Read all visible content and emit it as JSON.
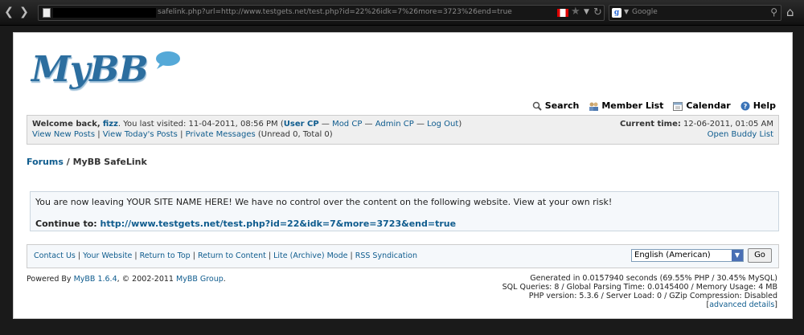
{
  "browser": {
    "url": "safelink.php?url=http://www.testgets.net/test.php?id=22%26idk=7%26more=3723%26end=true",
    "search_placeholder": "Google"
  },
  "logo": "MyBB",
  "toplinks": {
    "search": "Search",
    "member_list": "Member List",
    "calendar": "Calendar",
    "help": "Help"
  },
  "welcome": {
    "prefix": "Welcome back,",
    "user": "fizz",
    "visited": ". You last visited: 11-04-2011, 08:56 PM (",
    "user_cp": "User CP",
    "dash1": " — ",
    "mod_cp": "Mod CP",
    "dash2": " — ",
    "admin_cp": "Admin CP",
    "dash3": " — ",
    "log_out": "Log Out",
    "close": ")",
    "new_posts": "View New Posts",
    "pipe1": " | ",
    "today_posts": "View Today's Posts",
    "pipe2": " | ",
    "pm": "Private Messages",
    "pm_status": " (Unread 0, Total 0)",
    "time_label": "Current time:",
    "time_value": " 12-06-2011, 01:05 AM",
    "buddy_list": "Open Buddy List"
  },
  "breadcrumb": {
    "forums": "Forums",
    "sep": " / ",
    "current": "MyBB SafeLink"
  },
  "notice": {
    "message": "You are now leaving YOUR SITE NAME HERE! We have no control over the content on the following website. View at your own risk!",
    "continue_label": "Continue to: ",
    "continue_url": "http://www.testgets.net/test.php?id=22&idk=7&more=3723&end=true"
  },
  "footer": {
    "contact": "Contact Us",
    "website": "Your Website",
    "top": "Return to Top",
    "content": "Return to Content",
    "lite": "Lite (Archive) Mode",
    "rss": "RSS Syndication",
    "sep": " | ",
    "language": "English (American)",
    "go": "Go"
  },
  "powered": {
    "prefix": "Powered By ",
    "mybb": "MyBB 1.6.4",
    "middle": ", © 2002-2011 ",
    "group": "MyBB Group",
    "end": "."
  },
  "debug": {
    "line1": "Generated in 0.0157940 seconds (69.55% PHP / 30.45% MySQL)",
    "line2": "SQL Queries: 8 / Global Parsing Time: 0.0145400 / Memory Usage: 4 MB",
    "line3": "PHP version: 5.3.6 / Server Load: 0 / GZip Compression: Disabled",
    "bracket_open": "[",
    "advanced": "advanced details",
    "bracket_close": "]"
  }
}
